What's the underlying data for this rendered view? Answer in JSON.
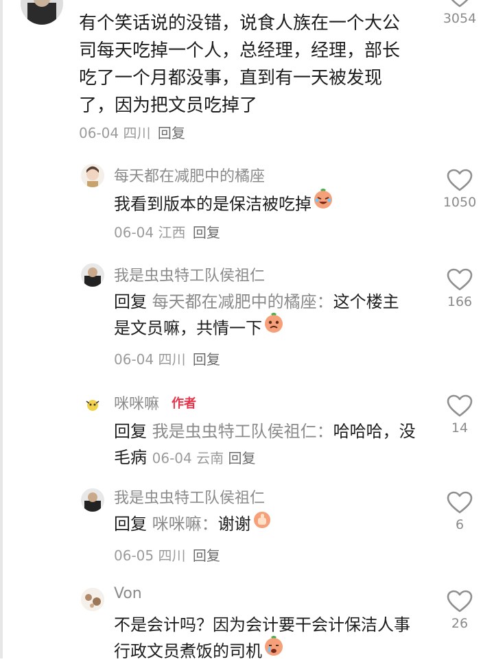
{
  "comments": [
    {
      "author": "",
      "text": "有个笑话说的没错，说食人族在一个大公司每天吃掉一个人，总经理，经理，部长吃了一个月都没事，直到有一天被发现了，因为把文员吃掉了",
      "date": "06-04",
      "location": "四川",
      "reply_label": "回复",
      "likes": "3054"
    },
    {
      "author": "每天都在减肥中的橘座",
      "text": "我看到版本的是保洁被吃掉",
      "date": "06-04",
      "location": "江西",
      "reply_label": "回复",
      "likes": "1050",
      "emoji": "laughing-crying-peach-emoji"
    },
    {
      "author": "我是虫虫特工队侯祖仁",
      "reply_prefix": "回复",
      "reply_to": "每天都在减肥中的橘座：",
      "text": "这个楼主是文员嘛，共情一下",
      "date": "06-04",
      "location": "四川",
      "reply_label": "回复",
      "likes": "166",
      "emoji": "sad-peach-emoji"
    },
    {
      "author": "咪咪嘛",
      "author_tag": "作者",
      "reply_prefix": "回复",
      "reply_to": "我是虫虫特工队侯祖仁：",
      "text": "哈哈哈，没毛病",
      "date": "06-04",
      "location": "云南",
      "reply_label": "回复",
      "likes": "14"
    },
    {
      "author": "我是虫虫特工队侯祖仁",
      "reply_prefix": "回复",
      "reply_to": "咪咪嘛：",
      "text": "谢谢",
      "date": "06-05",
      "location": "四川",
      "reply_label": "回复",
      "likes": "6",
      "emoji": "thumbs-up-emoji"
    },
    {
      "author": "Von",
      "text": "不是会计吗？因为会计要干会计保洁人事行政文员煮饭的司机",
      "likes": "26",
      "emoji": "crying-peach-emoji"
    }
  ],
  "colors": {
    "name_gray": "#8a8a8a",
    "text": "#1c1c1c",
    "author_tag": "#e8334a",
    "heart_stroke": "#8f8f8f"
  }
}
